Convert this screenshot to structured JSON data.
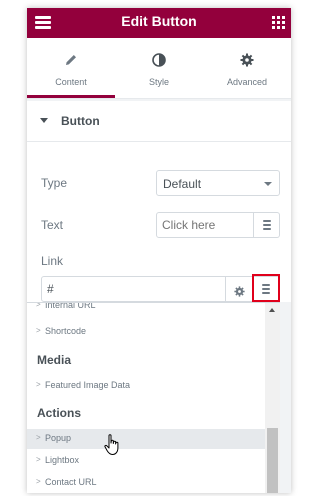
{
  "header": {
    "title": "Edit Button",
    "menu_icon": "hamburger-icon",
    "apps_icon": "grid-icon",
    "background": "#93003c"
  },
  "tabs": [
    {
      "label": "Content",
      "icon": "pencil-icon",
      "active": true
    },
    {
      "label": "Style",
      "icon": "contrast-icon",
      "active": false
    },
    {
      "label": "Advanced",
      "icon": "gear-icon",
      "active": false
    }
  ],
  "section": {
    "title": "Button"
  },
  "controls": {
    "type_label": "Type",
    "type_value": "Default",
    "text_label": "Text",
    "text_placeholder": "Click here",
    "link_label": "Link",
    "link_value": "#"
  },
  "dropdown": {
    "items_top": [
      {
        "label": "Internal URL"
      },
      {
        "label": "Shortcode"
      }
    ],
    "group_media": "Media",
    "items_media": [
      {
        "label": "Featured Image Data"
      }
    ],
    "group_actions": "Actions",
    "items_actions": [
      {
        "label": "Popup",
        "hovered": true
      },
      {
        "label": "Lightbox",
        "hovered": false
      },
      {
        "label": "Contact URL",
        "hovered": false
      }
    ],
    "chevron": ">"
  },
  "colors": {
    "accent": "#93003c",
    "highlight": "#e0001b"
  }
}
